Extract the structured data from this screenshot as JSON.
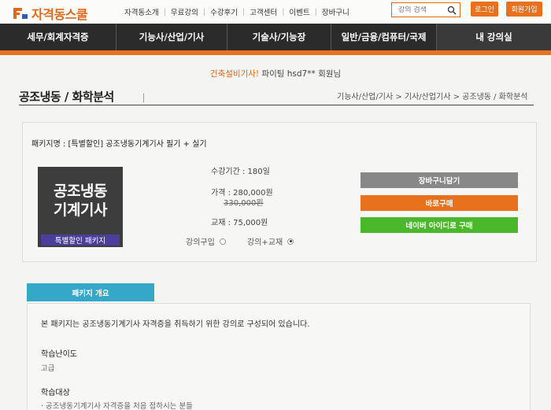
{
  "header": {
    "logo_text": "자격동스쿨",
    "nav": [
      "자격동소개",
      "무료강의",
      "수강후기",
      "고객센터",
      "이벤트",
      "장바구니"
    ],
    "search_placeholder": "강의 검색",
    "login_label": "로그인",
    "join_label": "회원가입"
  },
  "main_nav": [
    "세무/회계자격증",
    "기능사/산업/기사",
    "기술사/기능장",
    "일반/금융/컴퓨터/국제",
    "내 강의실"
  ],
  "greeting": {
    "prefix": "건축설비기사!",
    "rest": " 파이팅 hsd7** 회원님"
  },
  "page": {
    "title": "공조냉동 / 화학분석",
    "breadcrumb": "기능사/산업/기사 > 기사/산업기사 > 공조냉동 / 화학분석"
  },
  "package": {
    "name": "패키지명 : [특별할인] 공조냉동기계기사 필기 + 실기",
    "thumb_line1": "공조냉동",
    "thumb_line2": "기계기사",
    "thumb_badge": "특별할인 패키지",
    "period": "수강기간 : 180일",
    "price": "가격 : 280,000원",
    "old_price": "330,000원",
    "book": "교재 : 75,000원",
    "option1": "강의구입",
    "option2": "강의+교재",
    "selected_option": "강의+교재",
    "cart_label": "장바구니담기",
    "buy_label": "바로구매",
    "naver_label": "네이버 아이디로 구매"
  },
  "overview": {
    "tab_label": "패키지 개요",
    "intro": "본 패키지는 공조냉동기계기사 자격증을 취득하기 위한 강의로 구성되어 있습니다.",
    "difficulty_label": "학습난이도",
    "difficulty_value": "고급",
    "target_label": "학습대상",
    "target_value": "· 공조냉동기계기사 자격증을 처음 접하시는 분들"
  },
  "colors": {
    "brand_orange": "#e8711e",
    "nav_dark": "#2b2b2b",
    "naver_green": "#4bb82c",
    "tab_blue": "#35a7c9",
    "badge_purple": "#4a3f9a"
  }
}
